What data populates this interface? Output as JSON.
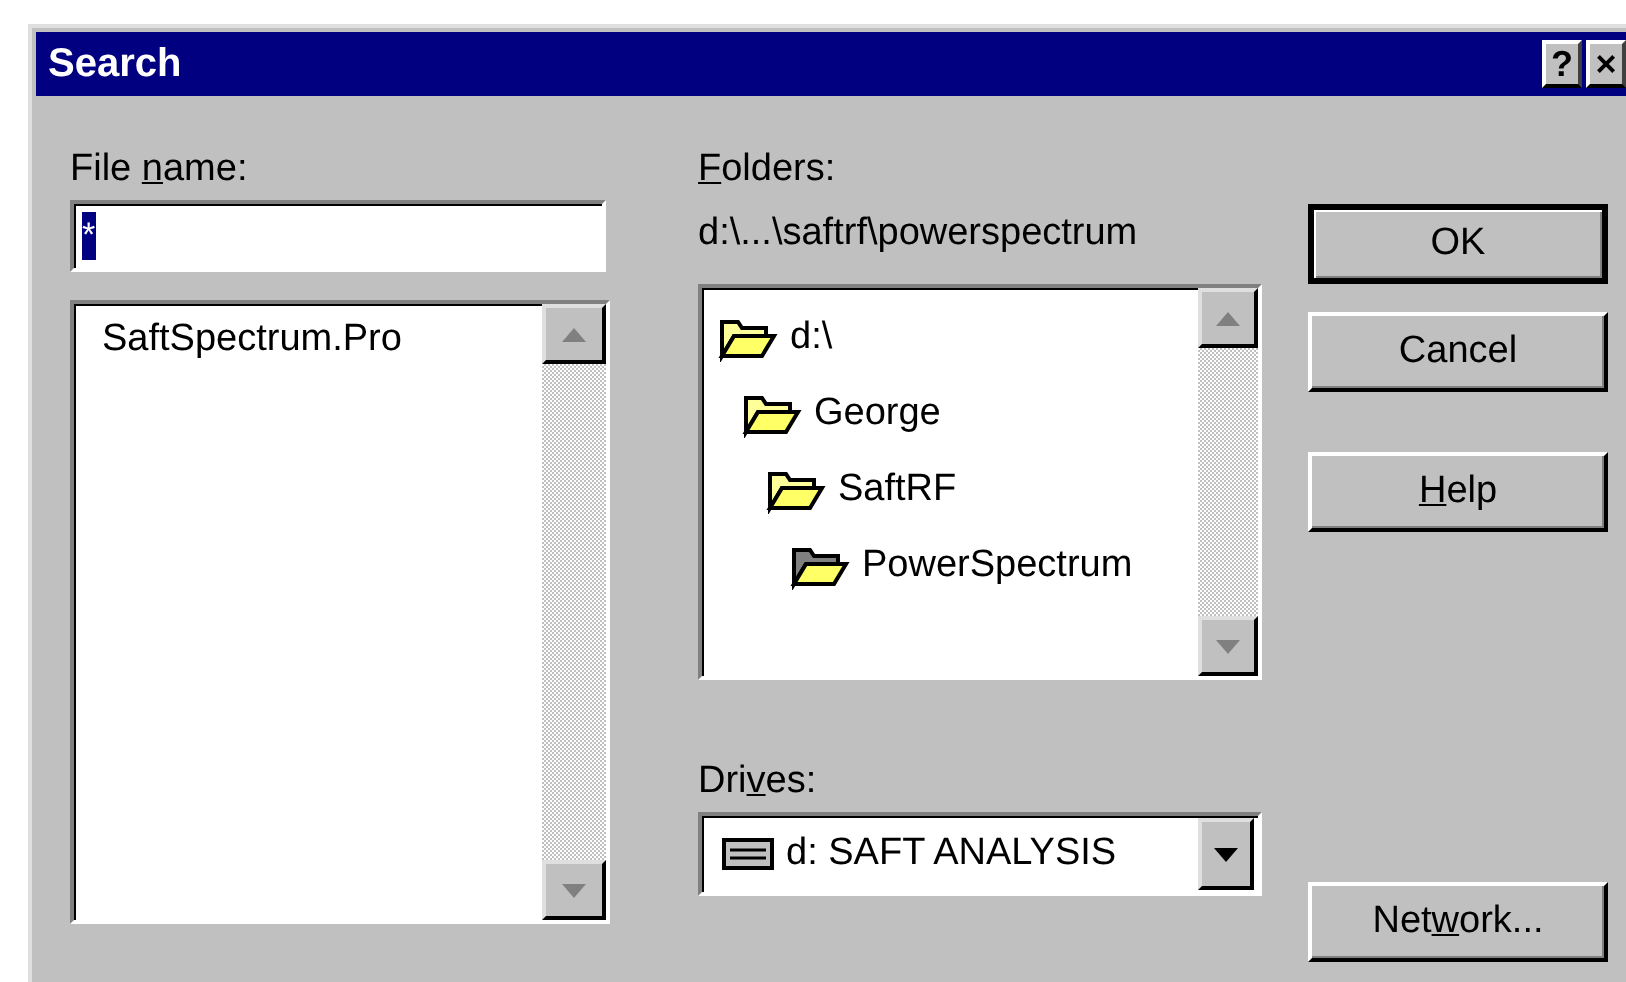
{
  "window": {
    "title": "Search",
    "title_buttons": [
      "?",
      "×"
    ]
  },
  "file_name": {
    "label": [
      {
        "text": "File ",
        "underline": false
      },
      {
        "text": "n",
        "underline": true
      },
      {
        "text": "ame:",
        "underline": false
      }
    ],
    "value": "*",
    "value_selected": true
  },
  "files": [
    {
      "name": "SaftSpectrum.Pro",
      "selected": false
    }
  ],
  "folders": {
    "label": [
      {
        "text": "F",
        "underline": true
      },
      {
        "text": "olders:",
        "underline": false
      }
    ],
    "path": "d:\\...\\saftrf\\powerspectrum",
    "tree": [
      {
        "name": "d:\\",
        "current": false,
        "children": [
          {
            "name": "George",
            "current": false,
            "children": [
              {
                "name": "SaftRF",
                "current": false,
                "children": [
                  {
                    "name": "PowerSpectrum",
                    "current": true
                  }
                ]
              }
            ]
          }
        ]
      }
    ]
  },
  "drives": {
    "label": [
      {
        "text": "Dri",
        "underline": false
      },
      {
        "text": "v",
        "underline": true
      },
      {
        "text": "es:",
        "underline": false
      }
    ],
    "value": "d: SAFT ANALYSIS"
  },
  "buttons": [
    {
      "label": [
        {
          "text": "OK",
          "underline": false
        }
      ],
      "default": true
    },
    {
      "label": [
        {
          "text": "Cancel",
          "underline": false
        }
      ],
      "default": false
    },
    {
      "label": [
        {
          "text": "H",
          "underline": true
        },
        {
          "text": "elp",
          "underline": false
        }
      ],
      "default": false
    },
    {
      "label": [
        {
          "text": "Net",
          "underline": false
        },
        {
          "text": "w",
          "underline": true
        },
        {
          "text": "ork...",
          "underline": false
        }
      ],
      "default": false
    }
  ]
}
